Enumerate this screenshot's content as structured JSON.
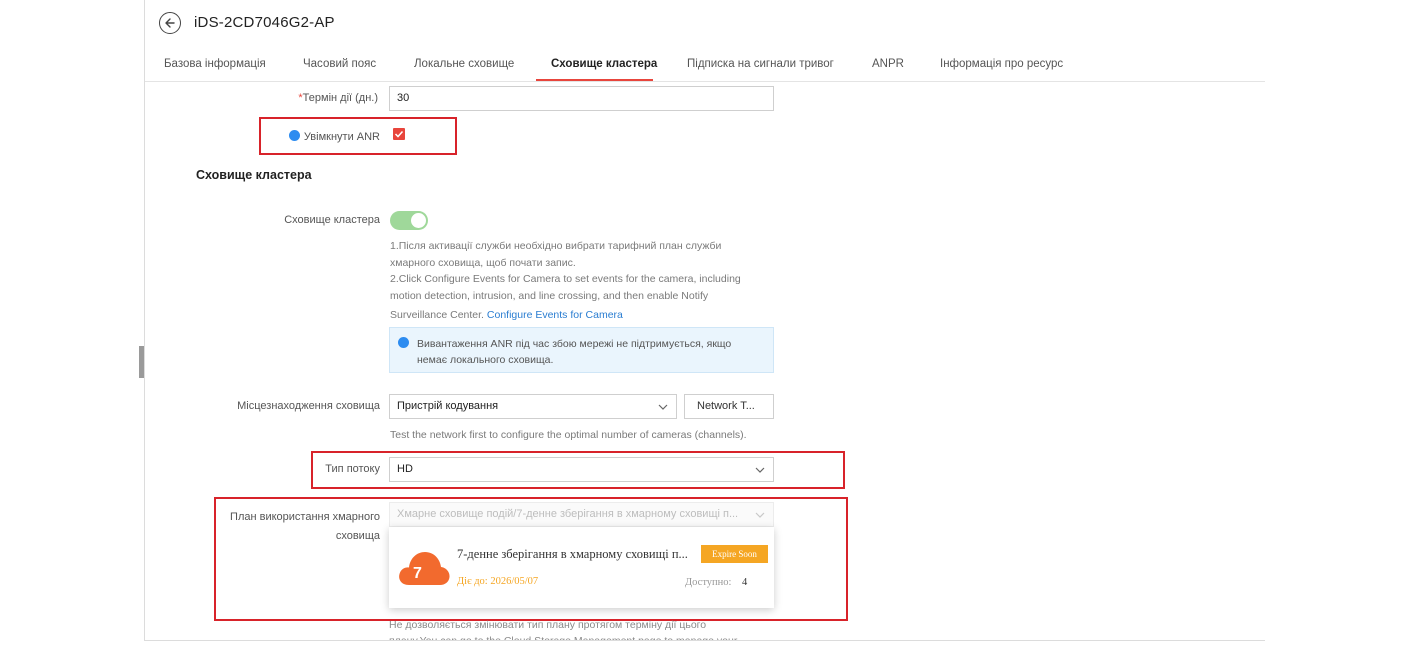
{
  "header": {
    "device_title": "iDS-2CD7046G2-AP",
    "back_icon": "arrow-left-circle-icon"
  },
  "tabs": [
    {
      "label": "Базова інформація"
    },
    {
      "label": "Часовий пояс"
    },
    {
      "label": "Локальне сховище"
    },
    {
      "label": "Сховище кластера",
      "active": true
    },
    {
      "label": "Підписка на сигнали тривог"
    },
    {
      "label": "ANPR"
    },
    {
      "label": "Інформація про ресурс"
    }
  ],
  "form": {
    "term": {
      "required_mark": "*",
      "label": "Термін дії (дн.)",
      "value": "30"
    },
    "anr": {
      "label": "Увімкнути ANR",
      "checked": true
    },
    "section_title": "Сховище кластера",
    "cluster_storage": {
      "label": "Сховище кластера",
      "enabled": true,
      "desc_line1": "1.Після активації служби необхідно вибрати тарифний план служби",
      "desc_line2": "хмарного сховища, щоб почати запис.",
      "desc_line3": "2.Click Configure Events for Camera to set events for the camera, including",
      "desc_line4": "motion detection, intrusion, and line crossing, and then enable Notify",
      "desc_line5": "Surveillance Center.",
      "link": "Configure Events for Camera"
    },
    "notice": {
      "line1": "Вивантаження ANR під час збою мережі не підтримується, якщо",
      "line2": "немає локального сховища."
    },
    "storage_location": {
      "label": "Місцезнаходження сховища",
      "value": "Пристрій кодування",
      "button": "Network T...",
      "hint": "Test the network first to configure the optimal number of cameras (channels)."
    },
    "stream_type": {
      "label": "Тип потоку",
      "value": "HD"
    },
    "cloud_plan": {
      "label_line1": "План використання хмарного",
      "label_line2": "сховища",
      "value": "Хмарне сховище подій/7-денне зберігання в хмарному сховищі п..."
    },
    "plan_option": {
      "icon": "cloud-icon",
      "days": "7",
      "name": "7-денне зберігання в хмарному сховищі п...",
      "badge": "Expire Soon",
      "valid_until": "Діє до: 2026/05/07",
      "available_label": "Доступно:",
      "available_value": "4"
    },
    "footer_note": {
      "line1": "Не дозволяється змінювати тип плану протягом терміну дії цього",
      "line2": "плану.You can go to the Cloud Storage Management page to manage your"
    }
  },
  "colors": {
    "accent_red": "#e8453c",
    "highlight_box": "#d8232a",
    "toggle_on": "#9fd89a",
    "info_blue": "#2d8cf0",
    "cloud_orange": "#f26a2e",
    "badge_orange": "#f5a623"
  }
}
